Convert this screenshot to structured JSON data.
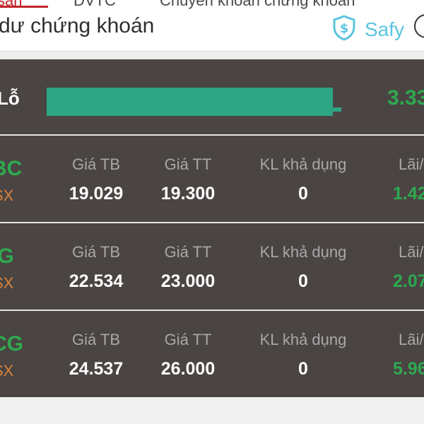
{
  "tabs": [
    {
      "label": "sản",
      "active": true
    },
    {
      "label": "DVTC",
      "active": false
    },
    {
      "label": "Chuyển khoản chứng khoán",
      "active": false
    }
  ],
  "header": {
    "title": "dư chứng khoán",
    "brand_label": "Safy",
    "brand_icon": "shield-dollar-icon"
  },
  "summary": {
    "label": "Lỗ",
    "value": "3.33",
    "bar_fraction": 0.97,
    "bar_color": "#2ea583"
  },
  "columns": {
    "avg_price": "Giá TB",
    "market_price": "Giá TT",
    "available_qty": "KL khả dụng",
    "profit": "Lãi/"
  },
  "holdings": [
    {
      "ticker": "BC",
      "exchange": "SX",
      "avg_price": "19.029",
      "market_price": "19.300",
      "available_qty": "0",
      "profit": "1.42"
    },
    {
      "ticker": "IG",
      "exchange": "SX",
      "avg_price": "22.534",
      "market_price": "23.000",
      "available_qty": "0",
      "profit": "2.07"
    },
    {
      "ticker": "CG",
      "exchange": "SX",
      "avg_price": "24.537",
      "market_price": "26.000",
      "available_qty": "0",
      "profit": "5.96"
    }
  ],
  "colors": {
    "accent": "#c3252c",
    "positive": "#2ea94f",
    "exchange": "#d9823b",
    "panel_bg": "#4a4443",
    "brand": "#5bc4e0"
  }
}
